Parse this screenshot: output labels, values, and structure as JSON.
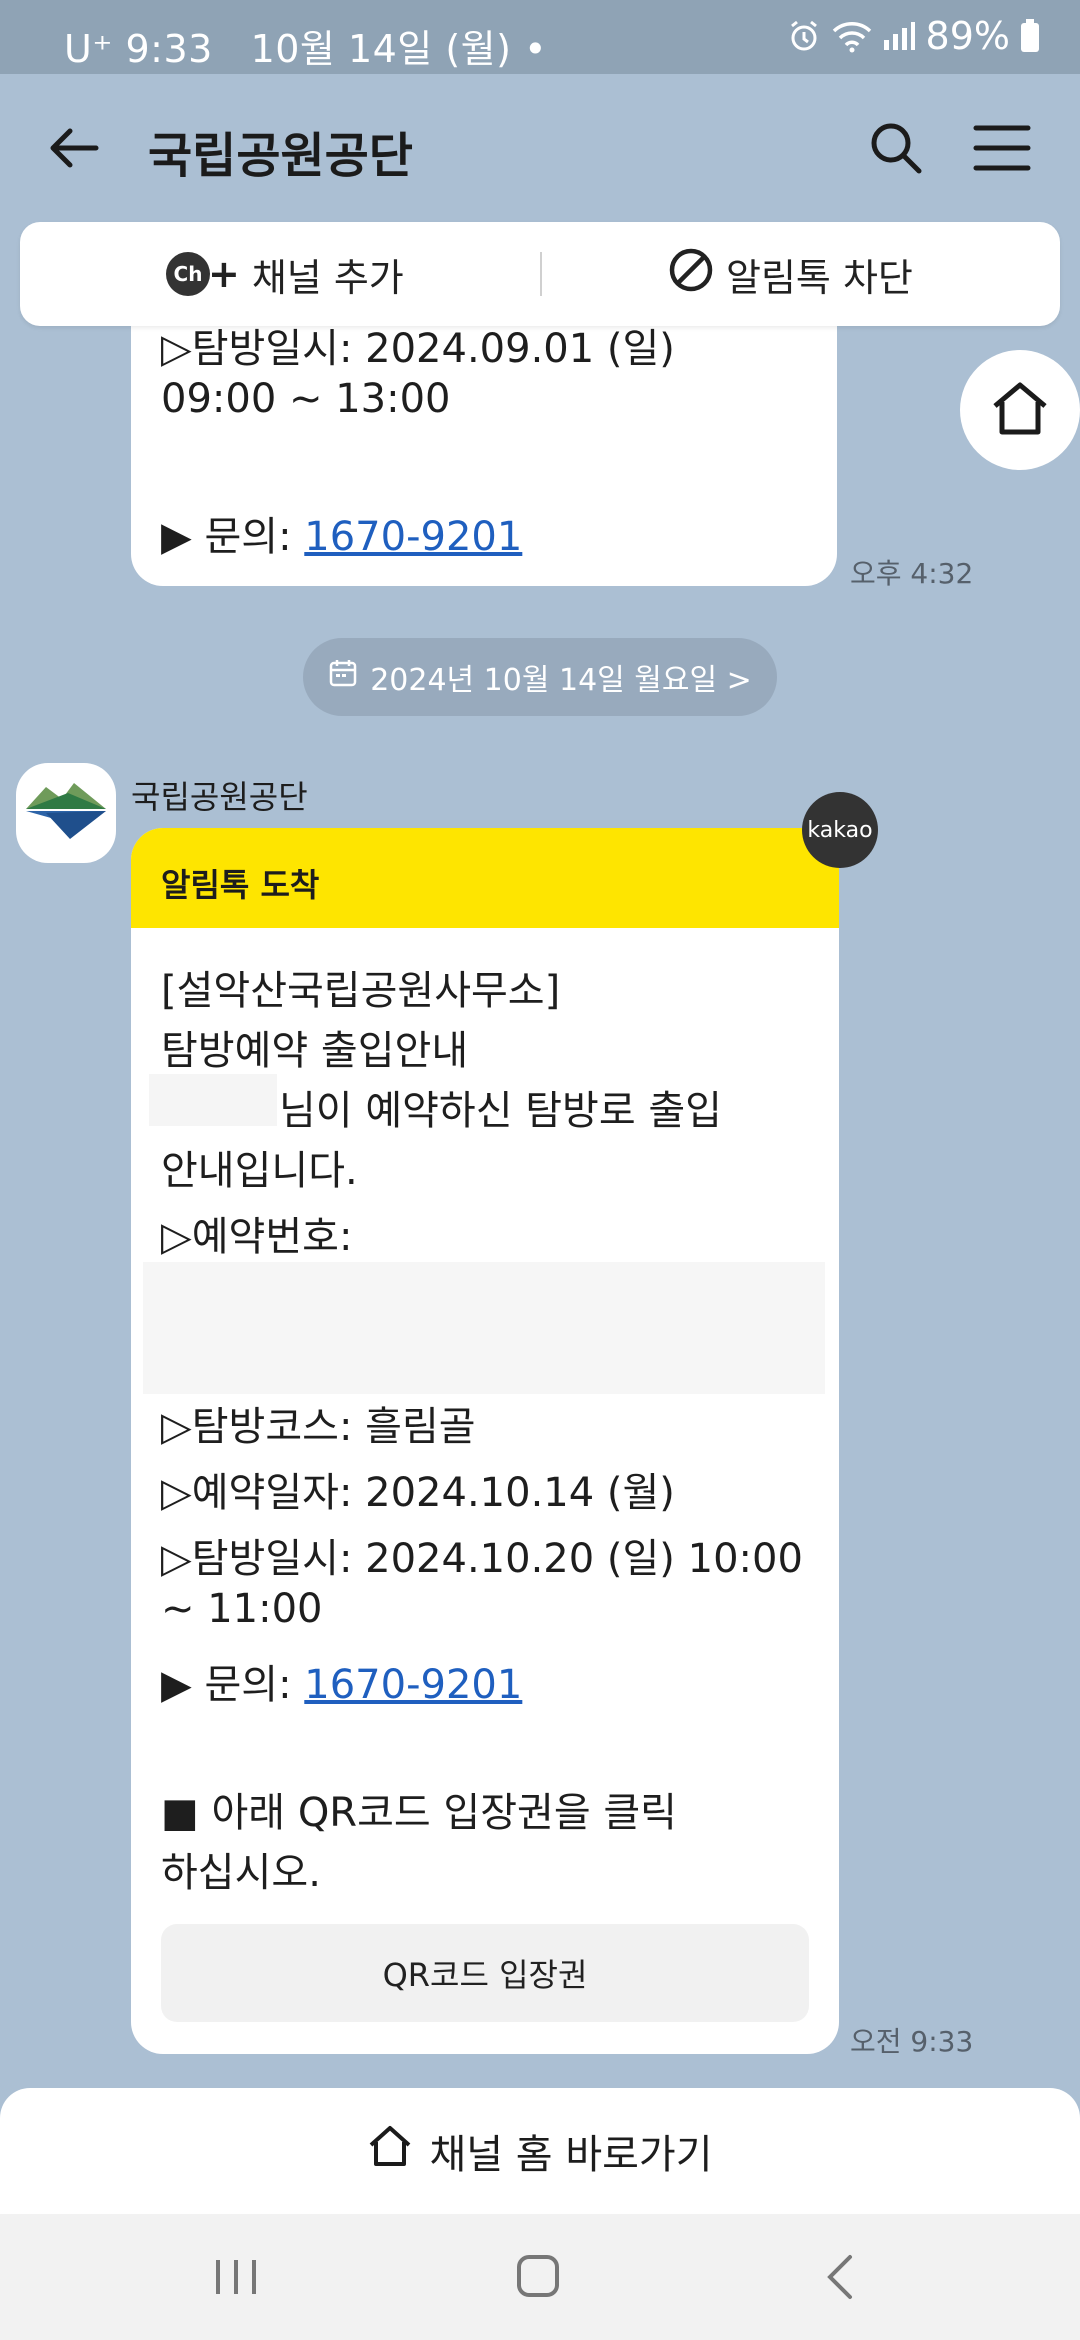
{
  "status_bar": {
    "carrier": "U⁺",
    "time": "9:33",
    "date": "10월 14일 (월)",
    "dot": "•",
    "battery": "89%",
    "icons": [
      "alarm-icon",
      "wifi-icon",
      "signal-icon",
      "battery-icon"
    ]
  },
  "header": {
    "title": "국립공원공단",
    "icons": [
      "back-arrow-icon",
      "search-icon",
      "menu-icon"
    ]
  },
  "channel_bar": {
    "add_channel_label": "채널 추가",
    "add_channel_badge": "Ch",
    "block_label": "알림톡 차단"
  },
  "messages": [
    {
      "lines": [
        "▷탐방일시: 2024.09.01 (일)",
        "09:00 ~ 13:00",
        "",
        "▶ 문의: "
      ],
      "phone": "1670-9201",
      "time": "오후 4:32"
    }
  ],
  "date_divider": "2024년 10월 14일 월요일 >",
  "notification": {
    "sender": "국립공원공단",
    "kakao_badge": "kakao",
    "header_label": "알림톡 도착",
    "lines": [
      "[설악산국립공원사무소]",
      "탐방예약 출입안내",
      "님이 예약하신 탐방로 출입",
      "안내입니다.",
      "▷예약번호:",
      "▷탐방코스: 흘림골",
      "▷예약일자: 2024.10.14 (월)",
      "▷탐방일시: 2024.10.20 (일) 10:00",
      "~ 11:00",
      "▶ 문의: ",
      "■ 아래 QR코드 입장권을 클릭",
      "하십시오."
    ],
    "phone": "1670-9201",
    "button_label": "QR코드 입장권",
    "time": "오전 9:33"
  },
  "home_bar": {
    "label": "채널 홈 바로가기"
  },
  "colors": {
    "background": "#abbfd3",
    "notification_header": "#fee500",
    "link": "#1f5fbf"
  }
}
